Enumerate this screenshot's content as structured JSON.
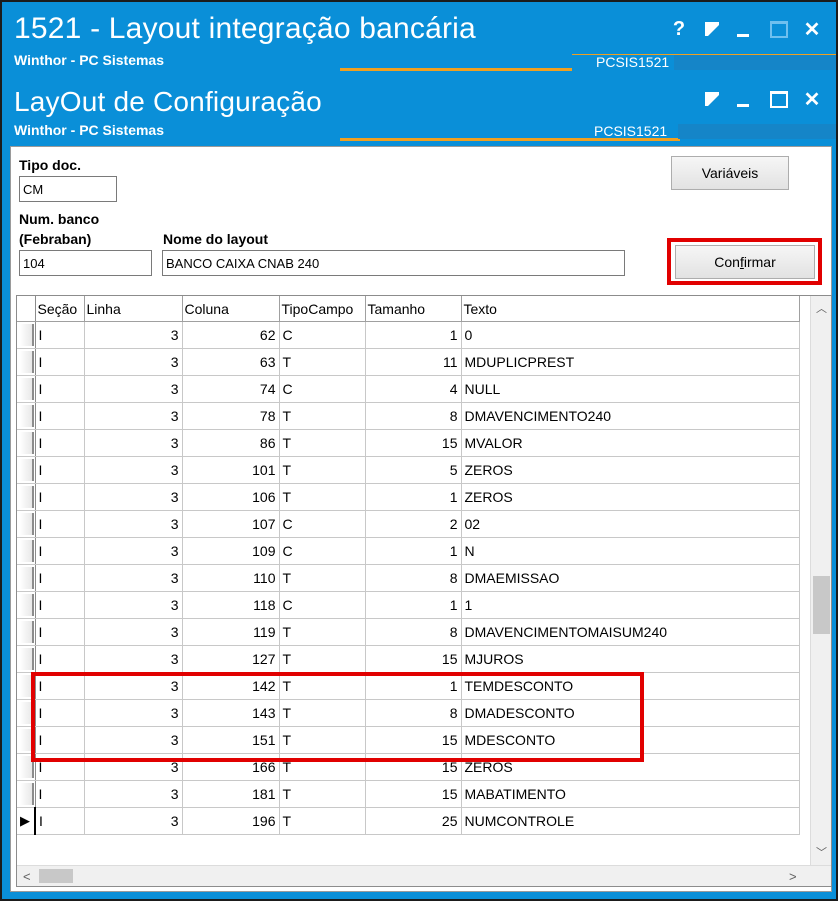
{
  "window1": {
    "title": "1521 - Layout integração bancária",
    "subtitle": "Winthor - PC Sistemas",
    "code": "PCSIS1521",
    "help": "?"
  },
  "window2": {
    "title": "LayOut de Configuração",
    "subtitle": "Winthor - PC Sistemas",
    "code": "PCSIS1521"
  },
  "form": {
    "tipo_doc_label": "Tipo doc.",
    "tipo_doc_value": "CM",
    "num_banco_label_1": "Num. banco",
    "num_banco_label_2": "(Febraban)",
    "num_banco_value": "104",
    "nome_layout_label": "Nome do layout",
    "nome_layout_value": "BANCO CAIXA CNAB 240",
    "variaveis_button": "Variáveis",
    "confirmar_button_pre": "Con",
    "confirmar_button_underline": "f",
    "confirmar_button_post": "irmar"
  },
  "grid": {
    "columns": [
      "Seção",
      "Linha",
      "Coluna",
      "TipoCampo",
      "Tamanho",
      "Texto"
    ],
    "rows": [
      [
        "I",
        "3",
        "62",
        "C",
        "1",
        "0"
      ],
      [
        "I",
        "3",
        "63",
        "T",
        "11",
        "MDUPLICPREST"
      ],
      [
        "I",
        "3",
        "74",
        "C",
        "4",
        "NULL"
      ],
      [
        "I",
        "3",
        "78",
        "T",
        "8",
        "DMAVENCIMENTO240"
      ],
      [
        "I",
        "3",
        "86",
        "T",
        "15",
        "MVALOR"
      ],
      [
        "I",
        "3",
        "101",
        "T",
        "5",
        "ZEROS"
      ],
      [
        "I",
        "3",
        "106",
        "T",
        "1",
        "ZEROS"
      ],
      [
        "I",
        "3",
        "107",
        "C",
        "2",
        "02"
      ],
      [
        "I",
        "3",
        "109",
        "C",
        "1",
        "N"
      ],
      [
        "I",
        "3",
        "110",
        "T",
        "8",
        "DMAEMISSAO"
      ],
      [
        "I",
        "3",
        "118",
        "C",
        "1",
        "1"
      ],
      [
        "I",
        "3",
        "119",
        "T",
        "8",
        "DMAVENCIMENTOMAISUM240"
      ],
      [
        "I",
        "3",
        "127",
        "T",
        "15",
        "MJUROS"
      ],
      [
        "I",
        "3",
        "142",
        "T",
        "1",
        "TEMDESCONTO"
      ],
      [
        "I",
        "3",
        "143",
        "T",
        "8",
        "DMADESCONTO"
      ],
      [
        "I",
        "3",
        "151",
        "T",
        "15",
        "MDESCONTO"
      ],
      [
        "I",
        "3",
        "166",
        "T",
        "15",
        "ZEROS"
      ],
      [
        "I",
        "3",
        "181",
        "T",
        "15",
        "MABATIMENTO"
      ],
      [
        "I",
        "3",
        "196",
        "T",
        "25",
        "NUMCONTROLE"
      ]
    ],
    "current_row_index": 18
  }
}
